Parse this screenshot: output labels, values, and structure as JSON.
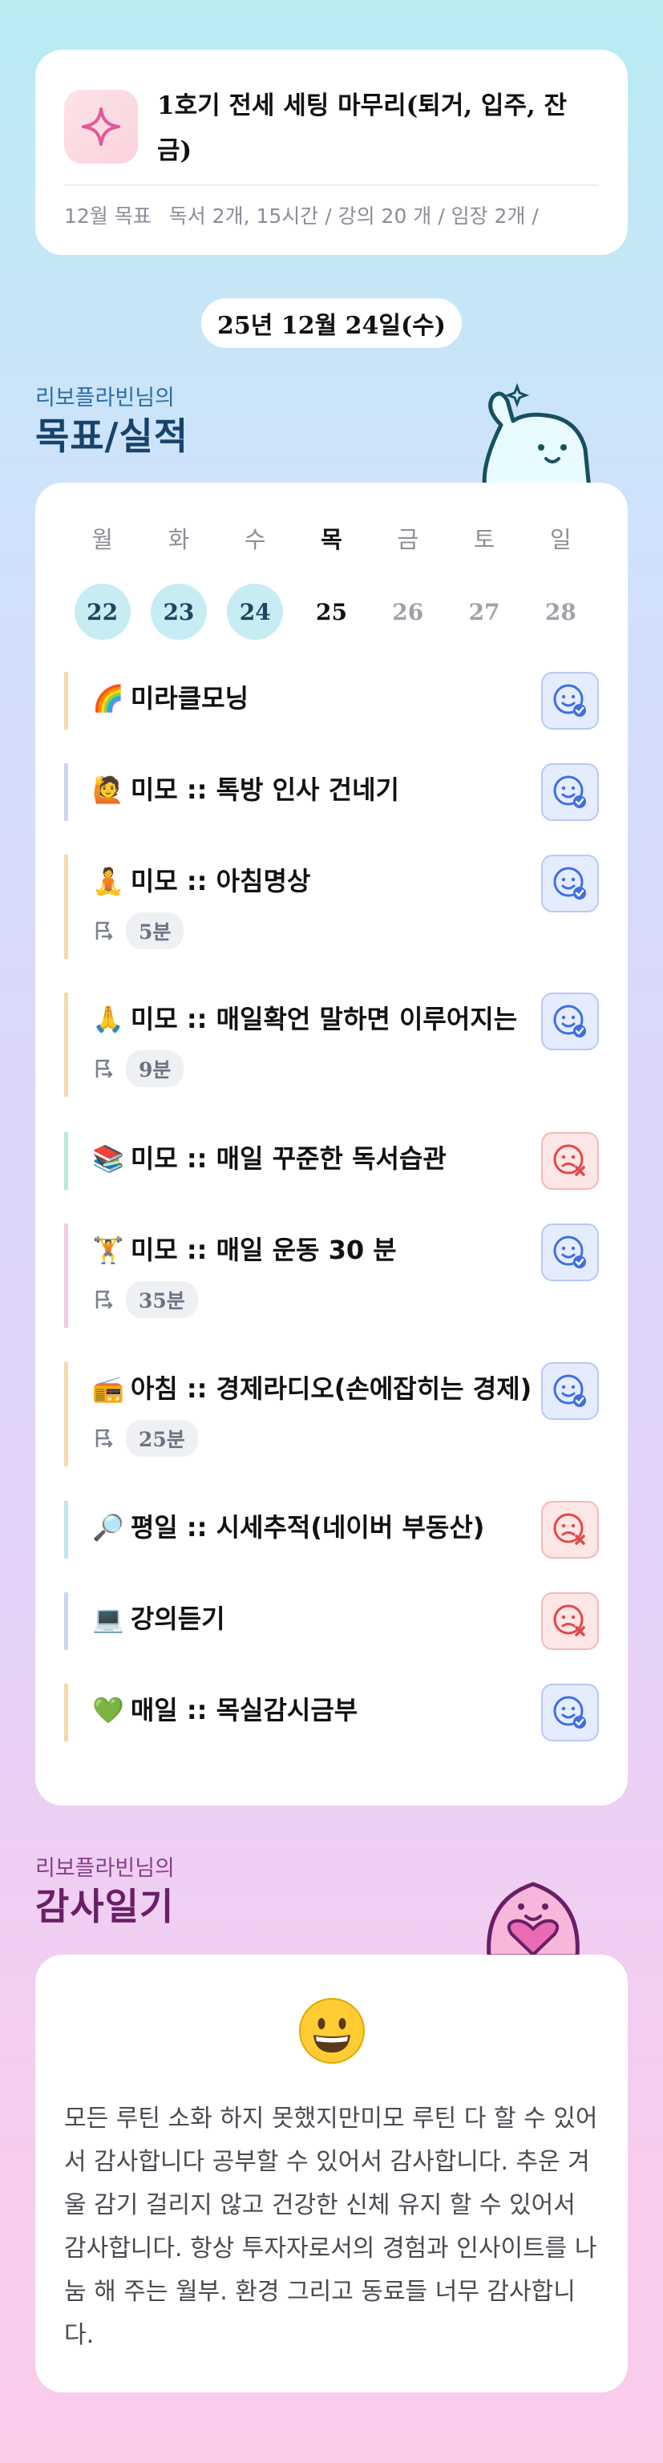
{
  "goal": {
    "title": "1호기 전세 세팅 마무리(퇴거, 입주, 잔금)",
    "label": "12월 목표",
    "summary": "독서 2개, 15시간 / 강의 20 개 / 임장 2개 /"
  },
  "date": "25년 12월 24일(수)",
  "routine_section": {
    "owner": "리보플라빈님의",
    "title": "목표/실적"
  },
  "week": {
    "days": [
      "월",
      "화",
      "수",
      "목",
      "금",
      "토",
      "일"
    ],
    "dates": [
      "22",
      "23",
      "24",
      "25",
      "26",
      "27",
      "28"
    ]
  },
  "routines": [
    {
      "emoji": "🌈",
      "title": "미라클모닝",
      "duration": "",
      "status": "done"
    },
    {
      "emoji": "🙋",
      "title": "미모 :: 톡방 인사 건네기",
      "duration": "",
      "status": "done"
    },
    {
      "emoji": "🧘",
      "title": "미모 :: 아침명상",
      "duration": "5분",
      "status": "done"
    },
    {
      "emoji": "🙏",
      "title": "미모 :: 매일확언 말하면 이루어지는",
      "duration": "9분",
      "status": "done"
    },
    {
      "emoji": "📚",
      "title": "미모 :: 매일 꾸준한 독서습관",
      "duration": "",
      "status": "missed"
    },
    {
      "emoji": "🏋",
      "title": "미모 :: 매일 운동 30 분",
      "duration": "35분",
      "status": "done"
    },
    {
      "emoji": "📻",
      "title": "아침 :: 경제라디오(손에잡히는 경제)",
      "duration": "25분",
      "status": "done"
    },
    {
      "emoji": "🔎",
      "title": "평일 :: 시세추적(네이버 부동산)",
      "duration": "",
      "status": "missed"
    },
    {
      "emoji": "💻",
      "title": "강의듣기",
      "duration": "",
      "status": "missed"
    },
    {
      "emoji": "💚",
      "title": "매일 :: 목실감시금부",
      "duration": "",
      "status": "done"
    }
  ],
  "gratitude_section": {
    "owner": "리보플라빈님의",
    "title": "감사일기"
  },
  "gratitude": {
    "text": "모든 루틴 소화 하지 못했지만미모 루틴 다 할 수 있어서 감사합니다 공부할 수 있어서 감사합니다. 추운 겨울 감기 걸리지 않고 건강한 신체 유지 할 수 있어서 감사합니다. 항상 투자자로서의 경험과 인사이트를 나눔 해 주는 월부. 환경 그리고 동료들 너무 감사합니다."
  },
  "colors": {
    "done_bg": "#e5ecfe",
    "missed_bg": "#fde6e6",
    "heading": "#18436a",
    "date_done": "#c7ecf4"
  }
}
